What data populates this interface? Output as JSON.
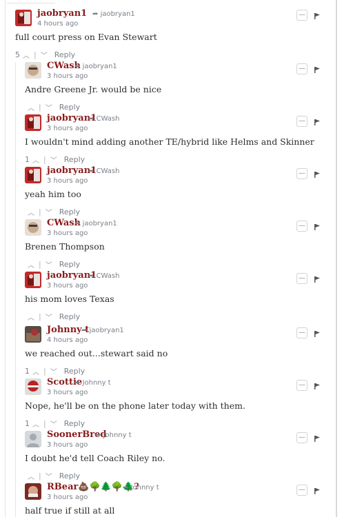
{
  "comments": [
    {
      "author": "jaobryan1",
      "reply_to": "jaobryan1",
      "time": "4 hours ago",
      "text": "full court press on Evan Stewart",
      "votes": "5",
      "reply_label": "Reply",
      "avatar": "jaobryan1-avatar"
    },
    {
      "author": "CWash",
      "reply_to": "jaobryan1",
      "time": "3 hours ago",
      "text": "Andre Greene Jr. would be nice",
      "votes": "",
      "reply_label": "Reply",
      "avatar": "cwash-avatar"
    },
    {
      "author": "jaobryan1",
      "reply_to": "CWash",
      "time": "3 hours ago",
      "text": "I wouldn't mind adding another TE/hybrid like Helms and Skinner",
      "votes": "1",
      "reply_label": "Reply",
      "avatar": "jaobryan1-avatar"
    },
    {
      "author": "jaobryan1",
      "reply_to": "CWash",
      "time": "3 hours ago",
      "text": "yeah him too",
      "votes": "",
      "reply_label": "Reply",
      "avatar": "jaobryan1-avatar"
    },
    {
      "author": "CWash",
      "reply_to": "jaobryan1",
      "time": "3 hours ago",
      "text": "Brenen Thompson",
      "votes": "",
      "reply_label": "Reply",
      "avatar": "cwash-avatar"
    },
    {
      "author": "jaobryan1",
      "reply_to": "CWash",
      "time": "3 hours ago",
      "text": "his mom loves Texas",
      "votes": "",
      "reply_label": "Reply",
      "avatar": "jaobryan1-avatar"
    },
    {
      "author": "Johnny t",
      "reply_to": "jaobryan1",
      "time": "4 hours ago",
      "text": "we reached out...stewart said no",
      "votes": "1",
      "reply_label": "Reply",
      "avatar": "johnny-avatar"
    },
    {
      "author": "Scottie",
      "reply_to": "Johnny t",
      "time": "3 hours ago",
      "text": "Nope, he'll be on the phone later today with them.",
      "votes": "1",
      "reply_label": "Reply",
      "avatar": "scottie-avatar"
    },
    {
      "author": "SoonerBred",
      "reply_to": "Johnny t",
      "time": "3 hours ago",
      "text": "I doubt he'd tell Coach Riley no.",
      "votes": "",
      "reply_label": "Reply",
      "avatar": "soonerbred-avatar"
    },
    {
      "author": "RBear💩🌳🌲🌳🌲?",
      "reply_to": "Johnny t",
      "time": "3 hours ago",
      "text": "half true if still at all",
      "votes": "",
      "reply_label": "",
      "avatar": "rbear-avatar"
    }
  ],
  "colors": {
    "author": "#8a1a1a",
    "meta": "#7a8088",
    "text": "#2a2e2e"
  },
  "icons": {
    "reply_arrow": "reply-arrow-icon",
    "upvote": "chevron-up-icon",
    "downvote": "chevron-down-icon",
    "collapse": "minus-icon",
    "flag": "flag-icon"
  }
}
